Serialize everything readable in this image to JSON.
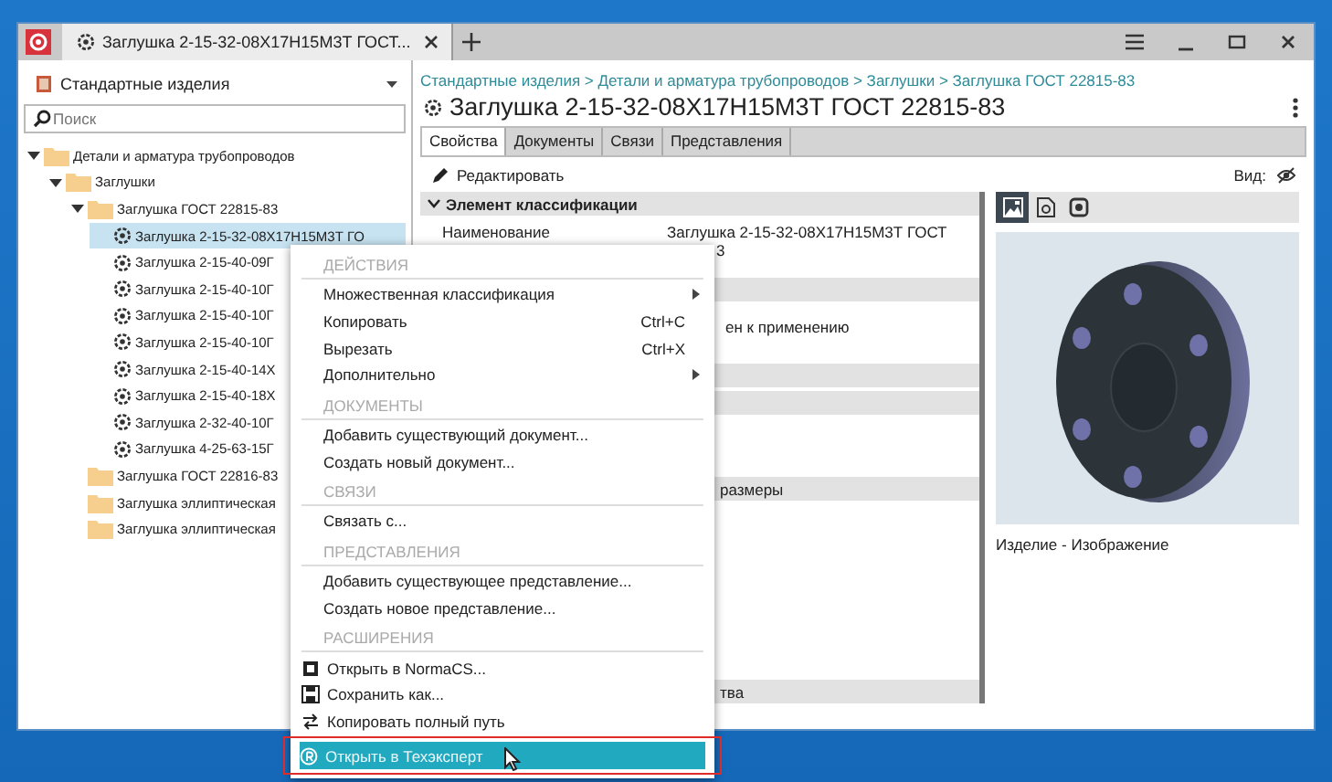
{
  "window": {
    "tab_title": "Заглушка 2-15-32-08Х17Н15М3Т ГОСТ..."
  },
  "sidebar": {
    "library": "Стандартные изделия",
    "search": {
      "placeholder": "Поиск"
    },
    "tree": [
      {
        "kind": "folder",
        "label": "Детали и арматура трубопроводов",
        "expanded": true,
        "selected": false,
        "children": [
          {
            "kind": "folder",
            "label": "Заглушки",
            "expanded": true,
            "selected": false,
            "children": [
              {
                "kind": "folder",
                "label": "Заглушка ГОСТ 22815-83",
                "expanded": true,
                "selected": false,
                "children": [
                  {
                    "kind": "part",
                    "label": "Заглушка 2-15-32-08Х17Н15М3Т ГО",
                    "selected": true
                  },
                  {
                    "kind": "part",
                    "label": "Заглушка 2-15-40-09Г",
                    "selected": false
                  },
                  {
                    "kind": "part",
                    "label": "Заглушка 2-15-40-10Г",
                    "selected": false
                  },
                  {
                    "kind": "part",
                    "label": "Заглушка 2-15-40-10Г",
                    "selected": false
                  },
                  {
                    "kind": "part",
                    "label": "Заглушка 2-15-40-10Г",
                    "selected": false
                  },
                  {
                    "kind": "part",
                    "label": "Заглушка 2-15-40-14Х",
                    "selected": false
                  },
                  {
                    "kind": "part",
                    "label": "Заглушка 2-15-40-18Х",
                    "selected": false
                  },
                  {
                    "kind": "part",
                    "label": "Заглушка 2-32-40-10Г",
                    "selected": false
                  },
                  {
                    "kind": "part",
                    "label": "Заглушка 4-25-63-15Г",
                    "selected": false
                  }
                ]
              },
              {
                "kind": "folder",
                "label": "Заглушка ГОСТ 22816-83",
                "expanded": false,
                "selected": false
              },
              {
                "kind": "folder",
                "label": "Заглушка эллиптическая",
                "expanded": false,
                "selected": false
              },
              {
                "kind": "folder",
                "label": "Заглушка эллиптическая",
                "expanded": false,
                "selected": false
              }
            ]
          }
        ]
      }
    ]
  },
  "detail": {
    "breadcrumb": "Стандартные изделия > Детали и арматура трубопроводов > Заглушки > Заглушка ГОСТ 22815-83",
    "title": "Заглушка 2-15-32-08Х17Н15М3Т ГОСТ 22815-83",
    "tabs": [
      {
        "label": "Свойства",
        "selected": true
      },
      {
        "label": "Документы",
        "selected": false
      },
      {
        "label": "Связи",
        "selected": false
      },
      {
        "label": "Представления",
        "selected": false
      }
    ],
    "edit_button": "Редактировать",
    "view_label": "Вид:",
    "properties": [
      {
        "kind": "section",
        "label": "Элемент классификации"
      },
      {
        "kind": "row",
        "label": "Наименование",
        "value": "Заглушка 2-15-32-08Х17Н15М3Т ГОСТ",
        "value_2": "3"
      },
      {
        "kind": "section"
      },
      {
        "kind": "row",
        "tail": "ен к применению"
      },
      {
        "kind": "section"
      },
      {
        "kind": "section"
      },
      {
        "kind": "row"
      },
      {
        "kind": "section",
        "tail": "размеры"
      },
      {
        "kind": "row"
      },
      {
        "kind": "row"
      },
      {
        "kind": "row"
      },
      {
        "kind": "section",
        "tail": "тва"
      }
    ],
    "preview_tabs": [
      {
        "selected": true
      },
      {
        "selected": false
      },
      {
        "selected": false
      }
    ],
    "preview_caption": "Изделие - Изображение"
  },
  "context_menu": [
    {
      "kind": "header",
      "label": "ДЕЙСТВИЯ"
    },
    {
      "kind": "item",
      "label": "Множественная классификация",
      "submenu": true,
      "selected": false
    },
    {
      "kind": "item",
      "label": "Копировать",
      "shortcut": "Ctrl+C",
      "submenu": false,
      "selected": false
    },
    {
      "kind": "item",
      "label": "Вырезать",
      "shortcut": "Ctrl+X",
      "submenu": false,
      "selected": false
    },
    {
      "kind": "item",
      "label": "Дополнительно",
      "submenu": true,
      "selected": false
    },
    {
      "kind": "header",
      "label": "ДОКУМЕНТЫ"
    },
    {
      "kind": "item",
      "label": "Добавить существующий документ...",
      "submenu": false,
      "selected": false
    },
    {
      "kind": "item",
      "label": "Создать новый документ...",
      "submenu": false,
      "selected": false
    },
    {
      "kind": "header",
      "label": "СВЯЗИ"
    },
    {
      "kind": "item",
      "label": "Связать с...",
      "submenu": false,
      "selected": false
    },
    {
      "kind": "header",
      "label": "ПРЕДСТАВЛЕНИЯ"
    },
    {
      "kind": "item",
      "label": "Добавить существующее представление...",
      "submenu": false,
      "selected": false
    },
    {
      "kind": "item",
      "label": "Создать новое представление...",
      "submenu": false,
      "selected": false
    },
    {
      "kind": "header",
      "label": "РАСШИРЕНИЯ"
    },
    {
      "kind": "tool",
      "label": "Открыть в NormaCS...",
      "submenu": false,
      "selected": false,
      "outlined": false
    },
    {
      "kind": "tool",
      "label": "Сохранить как...",
      "submenu": false,
      "selected": false,
      "outlined": false
    },
    {
      "kind": "tool",
      "label": "Копировать полный путь",
      "submenu": false,
      "selected": false,
      "outlined": false
    },
    {
      "kind": "tool",
      "label": "Открыть в Техэксперт",
      "submenu": false,
      "selected": true,
      "outlined": true
    }
  ]
}
